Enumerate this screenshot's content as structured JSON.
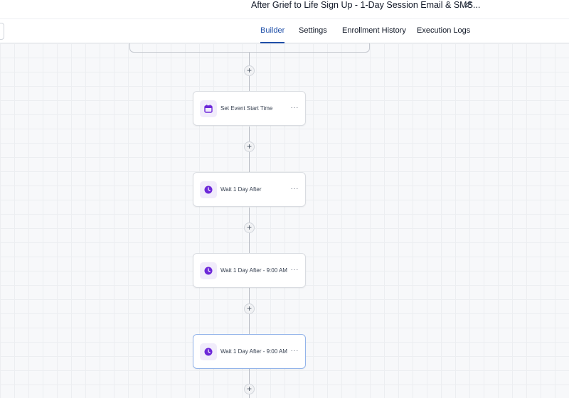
{
  "header": {
    "workflow_title": "After Grief to Life Sign Up - 1-Day Session Email & SMS...",
    "edit_icon": "pencil-icon"
  },
  "tabs": [
    {
      "label": "Builder",
      "active": true
    },
    {
      "label": "Settings",
      "active": false
    },
    {
      "label": "Enrollment History",
      "active": false
    },
    {
      "label": "Execution Logs",
      "active": false
    }
  ],
  "canvas": {
    "plus_symbol": "+",
    "nodes": [
      {
        "label": "Set Event Start Time",
        "icon": "calendar-icon",
        "menu": "···",
        "selected": false
      },
      {
        "label": "Wait 1 Day After",
        "icon": "clock-icon",
        "menu": "···",
        "selected": false
      },
      {
        "label": "Wait 1 Day After - 9:00 AM",
        "icon": "clock-icon",
        "menu": "···",
        "selected": false
      },
      {
        "label": "Wait 1 Day After - 9:00 AM",
        "icon": "clock-icon",
        "menu": "···",
        "selected": true
      }
    ]
  },
  "colors": {
    "accent": "#1f4fa8",
    "icon_purple": "#6d28d9",
    "icon_bg": "#f1ecfb",
    "selected_border": "#93b4ea"
  }
}
